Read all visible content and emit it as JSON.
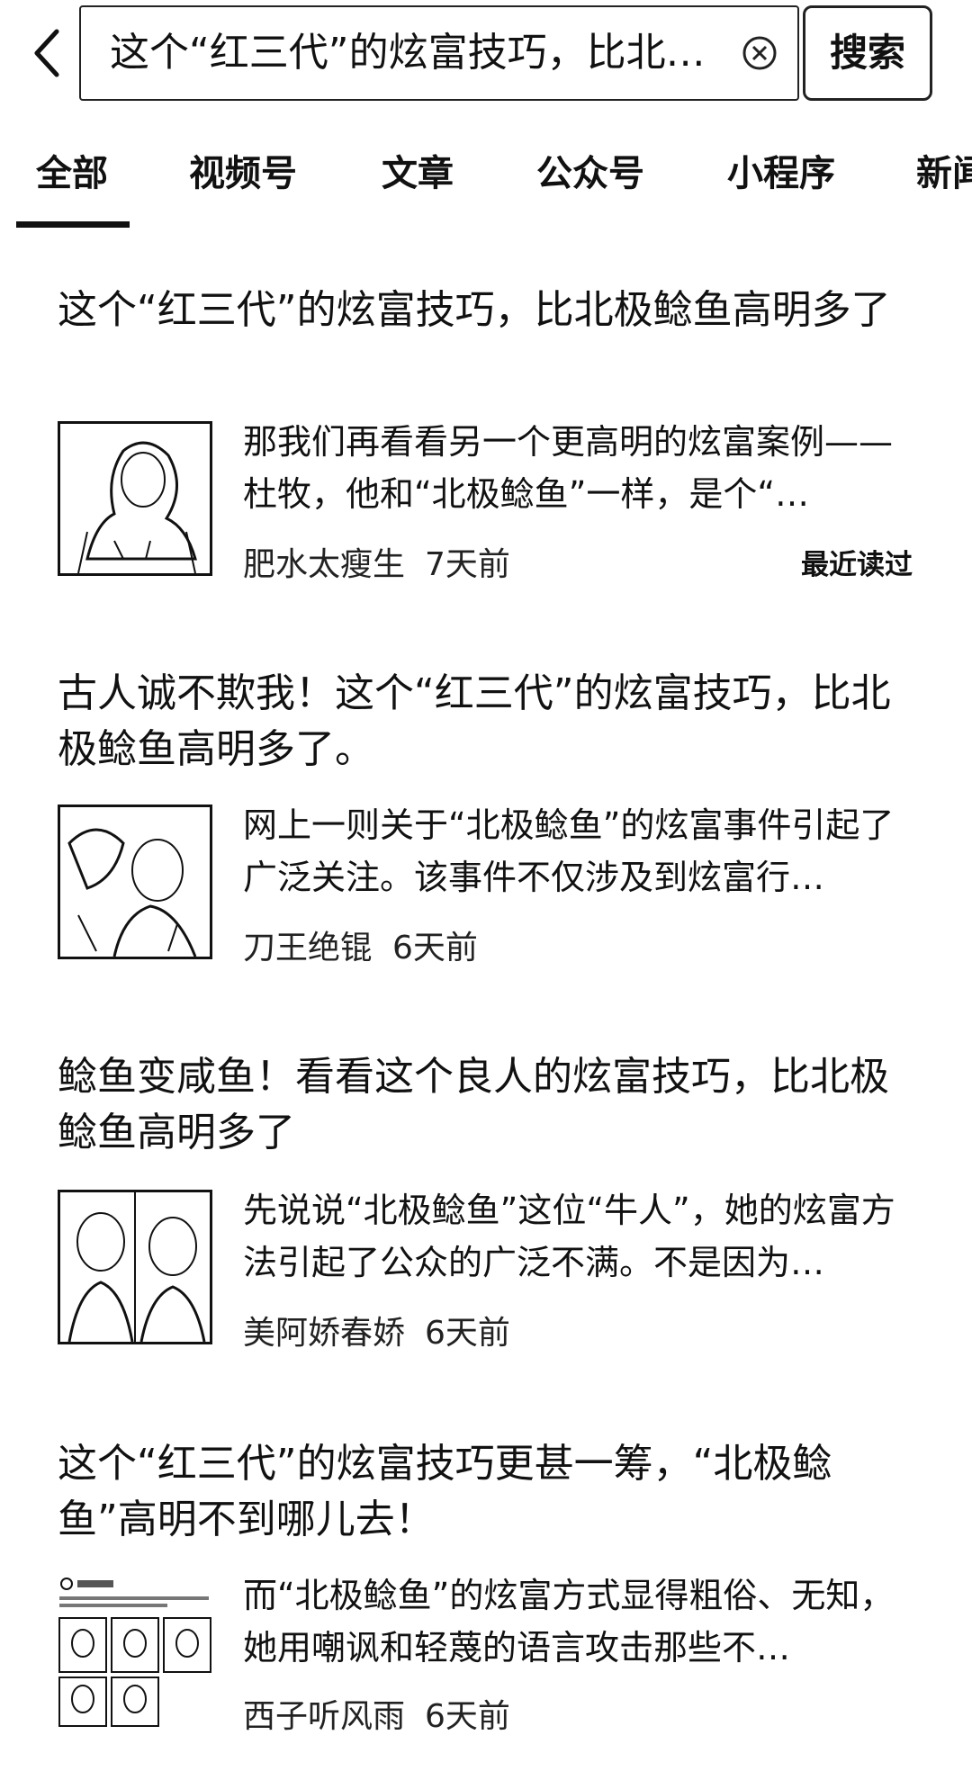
{
  "search": {
    "query": "这个“红三代”的炫富技巧，比北…",
    "button_label": "搜索"
  },
  "tabs": [
    {
      "label": "全部",
      "active": true
    },
    {
      "label": "视频号",
      "active": false
    },
    {
      "label": "文章",
      "active": false
    },
    {
      "label": "公众号",
      "active": false
    },
    {
      "label": "小程序",
      "active": false
    },
    {
      "label": "新闻",
      "active": false
    }
  ],
  "results": [
    {
      "title": "这个“红三代”的炫富技巧，比北极鲶鱼高明多了",
      "snippet": "那我们再看看另一个更高明的炫富案例——杜牧，他和“北极鲶鱼”一样，是个“…",
      "author": "肥水太瘦生",
      "time": "7天前",
      "tag": "最近读过"
    },
    {
      "title": "古人诚不欺我！这个“红三代”的炫富技巧，比北极鲶鱼高明多了。",
      "snippet": "网上一则关于“北极鲶鱼”的炫富事件引起了广泛关注。该事件不仅涉及到炫富行…",
      "author": "刀王绝锟",
      "time": "6天前"
    },
    {
      "title": "鲶鱼变咸鱼！看看这个良人的炫富技巧，比北极鲶鱼高明多了",
      "snippet": "先说说“北极鲶鱼”这位“牛人”，她的炫富方法引起了公众的广泛不满。不是因为…",
      "author": "美阿娇春娇",
      "time": "6天前"
    },
    {
      "title": "这个“红三代”的炫富技巧更甚一筹，“北极鲶鱼”高明不到哪儿去！",
      "snippet": "而“北极鲶鱼”的炫富方式显得粗俗、无知，她用嘲讽和轻蔑的语言攻击那些不…",
      "author": "西子听风雨",
      "time": "6天前"
    }
  ]
}
